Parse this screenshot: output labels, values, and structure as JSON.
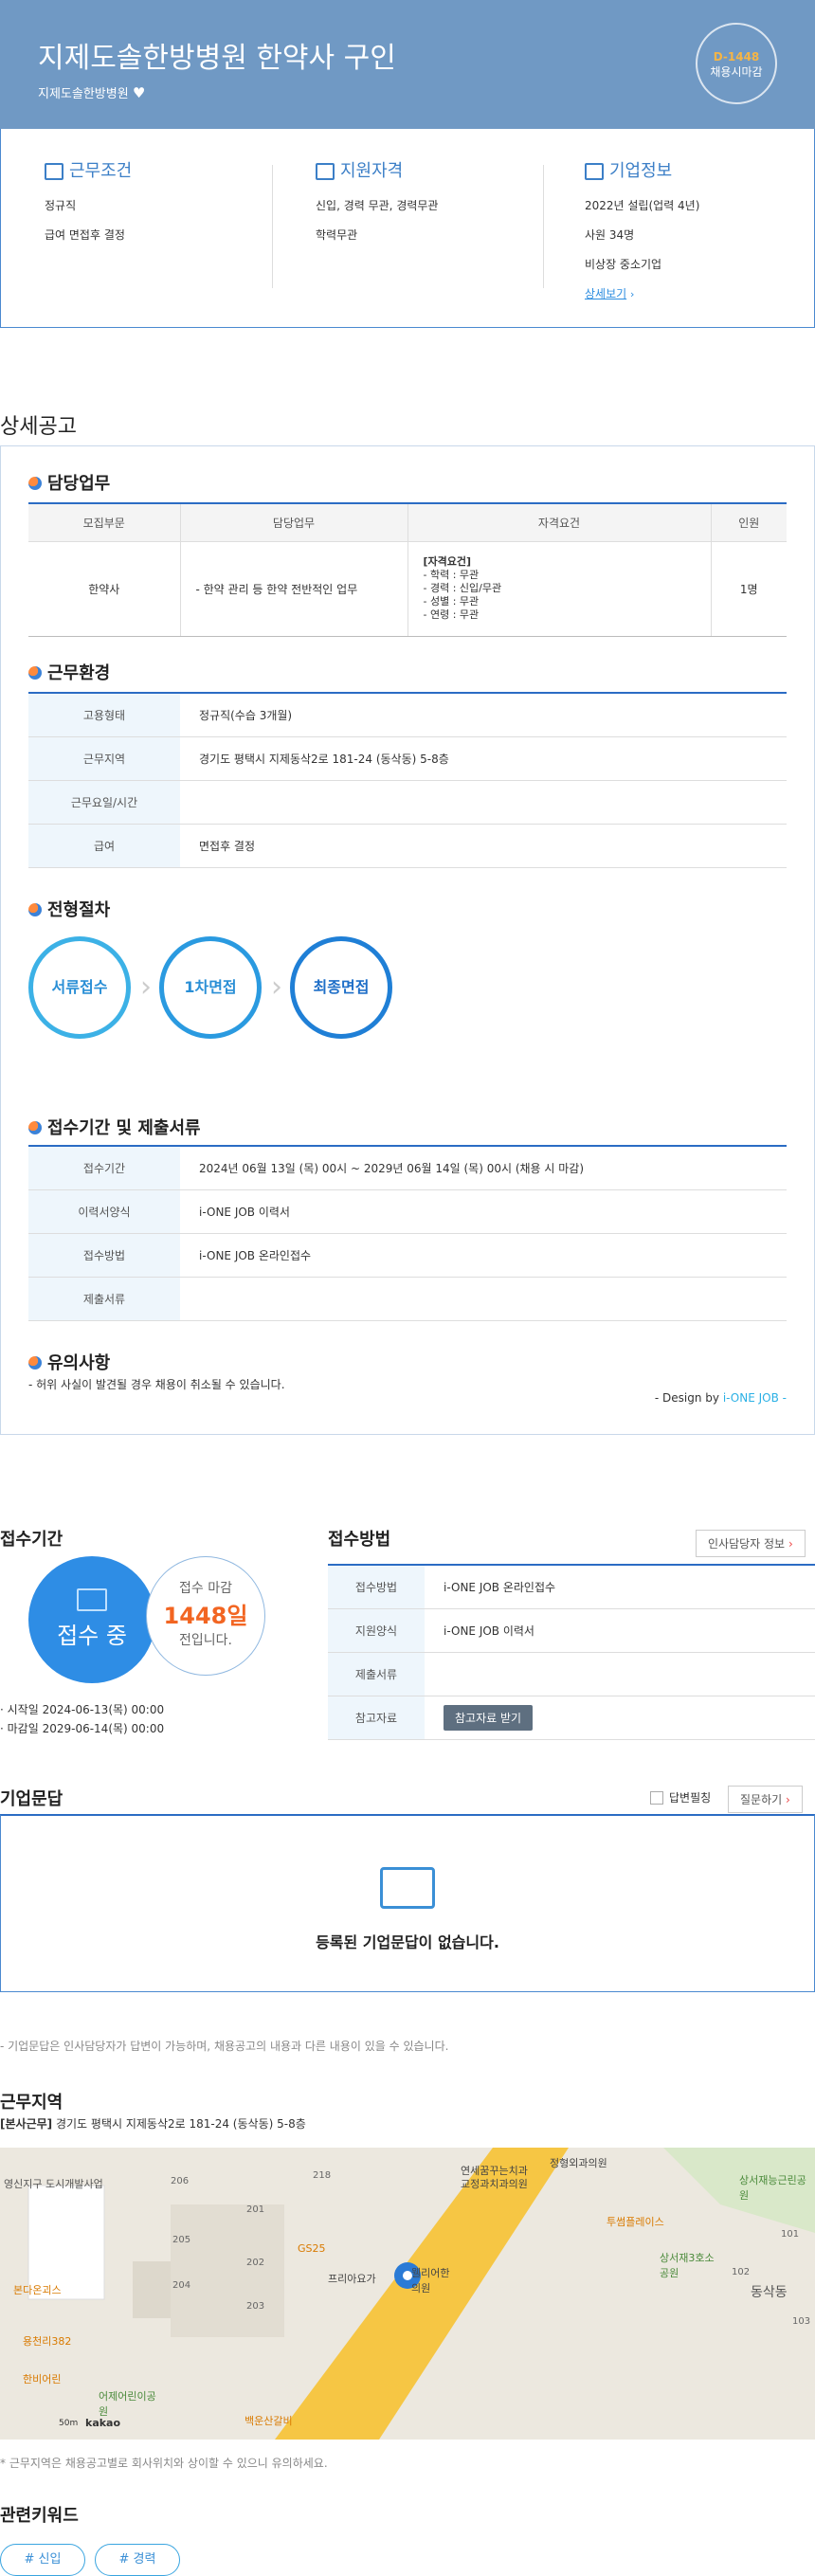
{
  "header": {
    "title": "지제도솔한방병원 한약사 구인",
    "company": "지제도솔한방병원",
    "dday": "D-1448",
    "dday_label": "채용시마감"
  },
  "summary": {
    "work": {
      "title": "근무조건",
      "lines": [
        "정규직",
        "급여 면접후 결정"
      ]
    },
    "qual": {
      "title": "지원자격",
      "lines": [
        "신입, 경력 무관, 경력무관",
        "학력무관"
      ]
    },
    "company": {
      "title": "기업정보",
      "lines": [
        "2022년 설립(업력 4년)",
        "사원 34명",
        "비상장 중소기업"
      ],
      "more": "상세보기"
    }
  },
  "detail": {
    "title": "상세공고",
    "duty": {
      "title": "담당업무",
      "headers": [
        "모집부문",
        "담당업무",
        "자격요건",
        "인원"
      ],
      "row": {
        "dept": "한약사",
        "task": "- 한약 관리 등 한약 전반적인 업무",
        "req_title": "[자격요건]",
        "req": [
          "- 학력 : 무관",
          "- 경력 : 신입/무관",
          "- 성별 : 무관",
          "- 연령 : 무관"
        ],
        "count": "1명"
      }
    },
    "env": {
      "title": "근무환경",
      "rows": [
        [
          "고용형태",
          "정규직(수습 3개월)"
        ],
        [
          "근무지역",
          "경기도 평택시 지제동삭2로 181-24 (동삭동) 5-8층"
        ],
        [
          "근무요일/시간",
          ""
        ],
        [
          "급여",
          "면접후 결정"
        ]
      ]
    },
    "process": {
      "title": "전형절차",
      "steps": [
        "서류접수",
        "1차면접",
        "최종면접"
      ]
    },
    "apply": {
      "title": "접수기간 및 제출서류",
      "rows": [
        [
          "접수기간",
          "2024년 06월 13일 (목) 00시 ~ 2029년 06월 14일 (목) 00시 (채용 시 마감)"
        ],
        [
          "이력서양식",
          "i-ONE JOB 이력서"
        ],
        [
          "접수방법",
          "i-ONE JOB 온라인접수"
        ],
        [
          "제출서류",
          ""
        ]
      ]
    },
    "notice": {
      "title": "유의사항",
      "text": "- 허위 사실이 발견될 경우 채용이 취소될 수 있습니다."
    },
    "design_prefix": "- Design by ",
    "design_brand": "i-ONE JOB -"
  },
  "period": {
    "title": "접수기간",
    "status": "접수 중",
    "deadline_label": "접수 마감",
    "days": "1448일",
    "remain": "전입니다.",
    "start": "시작일 2024-06-13(목) 00:00",
    "end": "마감일 2029-06-14(목) 00:00"
  },
  "method": {
    "title": "접수방법",
    "hr_btn": "인사담당자 정보",
    "rows": [
      [
        "접수방법",
        "i-ONE JOB 온라인접수"
      ],
      [
        "지원양식",
        "i-ONE JOB 이력서"
      ],
      [
        "제출서류",
        ""
      ],
      [
        "참고자료",
        ""
      ]
    ],
    "ref_btn": "참고자료 받기"
  },
  "qa": {
    "title": "기업문답",
    "check_label": "답변필칭",
    "ask_btn": "질문하기",
    "empty": "등록된 기업문답이 없습니다.",
    "note": "- 기업문답은 인사담당자가 답변이 가능하며, 채용공고의 내용과 다른 내용이 있을 수 있습니다."
  },
  "location": {
    "title": "근무지역",
    "tag": "[본사근무]",
    "address": "경기도 평택시 지제동삭2로 181-24 (동삭동) 5-8층",
    "note": "* 근무지역은 채용공고별로 회사위치와 상이할 수 있으니 유의하세요.",
    "map_labels": [
      "영신지구 도시개발사업",
      "206",
      "218",
      "201",
      "205",
      "202",
      "GS25",
      "204",
      "203",
      "본다온괴스",
      "프리아요가",
      "웰리어한의원",
      "연세꿈꾸는치과",
      "교정과치과의원",
      "정형외과의원",
      "투썸플레이스",
      "상서재능근린공원",
      "101",
      "102",
      "103",
      "상서재3호소공원",
      "동삭동",
      "용천리382",
      "한비어린",
      "어제어린이공원",
      "백운산갈비",
      "50m",
      "kakao"
    ]
  },
  "keywords": {
    "title": "관련키워드",
    "items": [
      "# 신입",
      "# 경력"
    ]
  }
}
